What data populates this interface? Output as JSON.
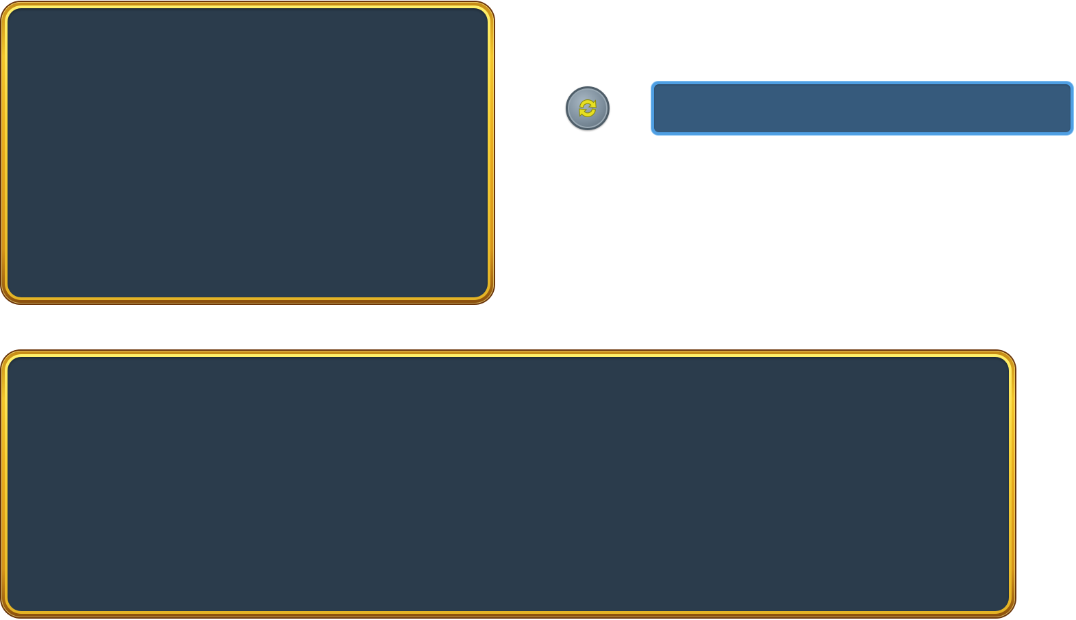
{
  "panels": {
    "top_panel": {
      "label": ""
    },
    "bottom_panel": {
      "label": ""
    }
  },
  "controls": {
    "refresh_button": {
      "icon": "refresh-icon",
      "label": ""
    }
  },
  "bar": {
    "label": ""
  },
  "colors": {
    "panel_fill": "#2b3c4c",
    "panel_frame": "#f3c52c",
    "bar_fill": "#365a7c",
    "bar_border": "#4f9fe3",
    "icon_color": "#e8e020"
  }
}
